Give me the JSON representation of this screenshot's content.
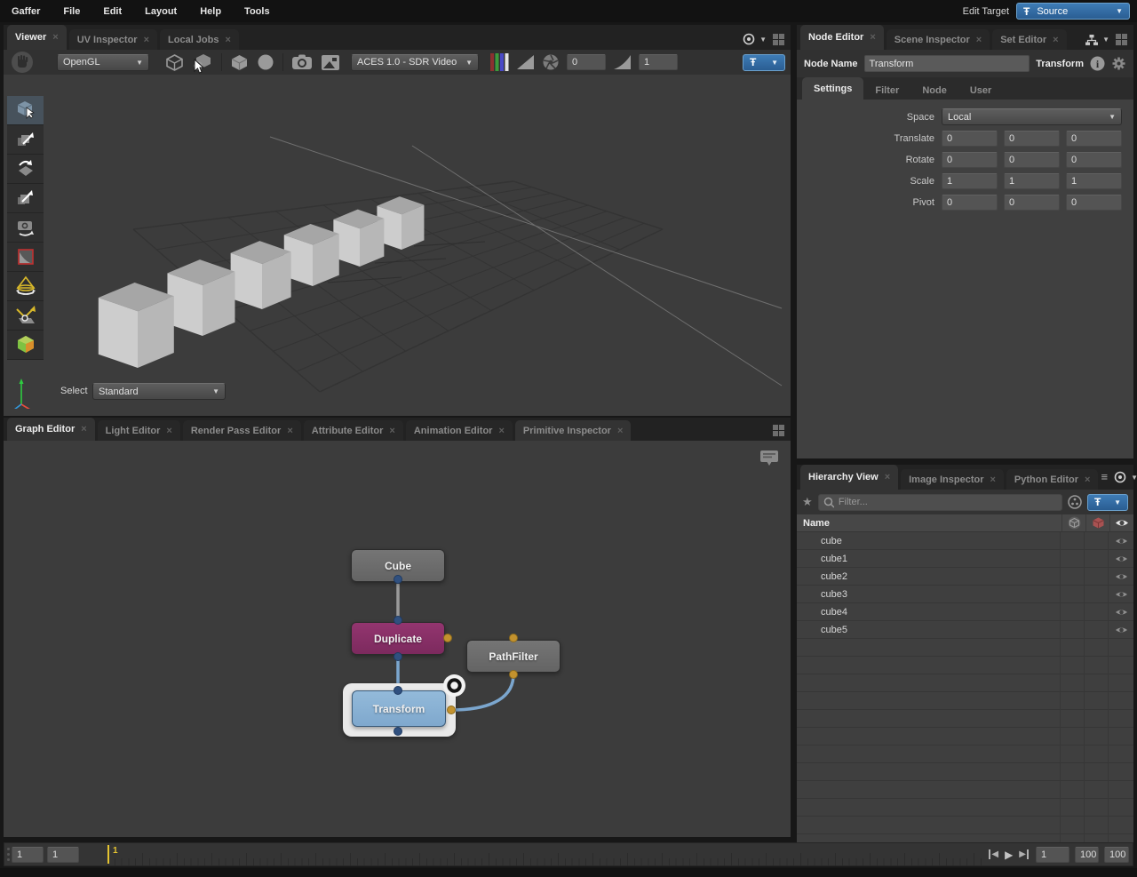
{
  "glyphs": {
    "close": "×",
    "dropdown": "▼",
    "star": "★",
    "menu": "≡",
    "pin": "Ŧ",
    "play": "▶",
    "step_fwd": "▶",
    "step_back": "◀",
    "info": "i"
  },
  "colors": {
    "accent_blue": "#2f6da7",
    "playhead_yellow": "#e5c431",
    "node_magenta": "#8a2e6a",
    "node_blue": "#88b0d6",
    "node_grey": "#6e6e6e",
    "connector_blue": "#30507f",
    "connector_orange": "#c3922e"
  },
  "menubar": {
    "items": [
      "Gaffer",
      "File",
      "Edit",
      "Layout",
      "Help",
      "Tools"
    ],
    "edit_target_label": "Edit Target",
    "edit_target_value": "Source"
  },
  "viewer": {
    "tabs": [
      {
        "label": "Viewer"
      },
      {
        "label": "UV Inspector"
      },
      {
        "label": "Local Jobs"
      }
    ],
    "renderer": "OpenGL",
    "display_transform": "ACES 1.0 - SDR Video",
    "exposure": "0",
    "gamma": "1",
    "select_label": "Select",
    "select_mode": "Standard"
  },
  "graph_editor": {
    "tabs": [
      {
        "label": "Graph Editor"
      },
      {
        "label": "Light Editor"
      },
      {
        "label": "Render Pass Editor"
      },
      {
        "label": "Attribute Editor"
      },
      {
        "label": "Animation Editor"
      },
      {
        "label": "Primitive Inspector"
      }
    ],
    "nodes": {
      "cube": "Cube",
      "duplicate": "Duplicate",
      "pathfilter": "PathFilter",
      "transform": "Transform"
    }
  },
  "node_editor": {
    "tabs": [
      {
        "label": "Node Editor"
      },
      {
        "label": "Scene Inspector"
      },
      {
        "label": "Set Editor"
      }
    ],
    "node_name_label": "Node Name",
    "node_name_value": "Transform",
    "node_type": "Transform",
    "subtabs": [
      {
        "label": "Settings"
      },
      {
        "label": "Filter"
      },
      {
        "label": "Node"
      },
      {
        "label": "User"
      }
    ],
    "space": {
      "label": "Space",
      "value": "Local"
    },
    "translate": {
      "label": "Translate",
      "values": [
        "0",
        "0",
        "0"
      ]
    },
    "rotate": {
      "label": "Rotate",
      "values": [
        "0",
        "0",
        "0"
      ]
    },
    "scale": {
      "label": "Scale",
      "values": [
        "1",
        "1",
        "1"
      ]
    },
    "pivot": {
      "label": "Pivot",
      "values": [
        "0",
        "0",
        "0"
      ]
    }
  },
  "hierarchy": {
    "tabs": [
      {
        "label": "Hierarchy View"
      },
      {
        "label": "Image Inspector"
      },
      {
        "label": "Python Editor"
      }
    ],
    "filter_placeholder": "Filter...",
    "name_header": "Name",
    "rows": [
      "cube",
      "cube1",
      "cube2",
      "cube3",
      "cube4",
      "cube5"
    ]
  },
  "timeline": {
    "start_frame": "1",
    "increment": "1",
    "playhead_label": "1",
    "current_frame": "1",
    "end_frame": "100",
    "playback_end": "100"
  }
}
